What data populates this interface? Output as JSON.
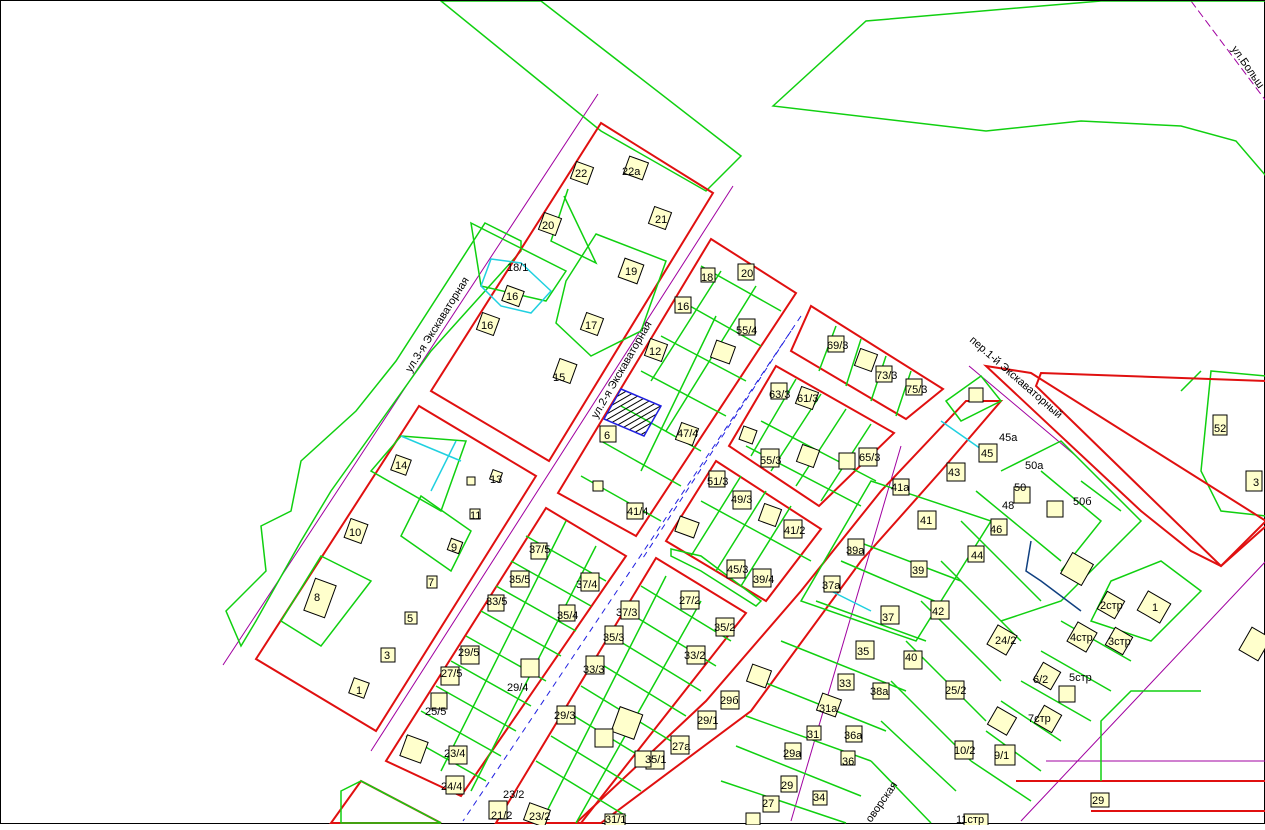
{
  "map": {
    "colors": {
      "parcel_red": "#e01010",
      "lot_green": "#10d010",
      "road_magenta": "#a000a0",
      "road_pink": "#c060c0",
      "building_fill": "#ffffcc",
      "cyan": "#20d0e0",
      "blue_dashed": "#2020e0",
      "dark_red": "#a00000"
    },
    "streets": {
      "ekskavatornaya3": "ул.3-я Экскаваторная",
      "ekskavatornaya2": "ул.2-я Экскаваторная",
      "per_ekskavatorny1": "пер.1-й Экскаваторный",
      "bolshaya": "ул.Больш",
      "ovorskaya": "оворская"
    },
    "lots": {
      "l22": "22",
      "l22a": "22а",
      "l21": "21",
      "l20": "20",
      "l19": "19",
      "l18_1": "18/1",
      "l16a": "16",
      "l16b": "16",
      "l17": "17",
      "l15": "15",
      "l14": "14",
      "l13": "13",
      "l12a": "12",
      "l11": "11",
      "l10": "10",
      "l9": "9",
      "l8": "8",
      "l7": "7",
      "l5": "5",
      "l3": "3",
      "l1": "1",
      "l18": "18",
      "l20b": "20",
      "l16c": "16",
      "l55_4": "55/4",
      "l12b": "12",
      "l6": "6",
      "l47_4": "47/4",
      "l41_4": "41/4",
      "l69_3": "69/3",
      "l73_3": "73/3",
      "l75_3": "75/3",
      "l63_3": "63/3",
      "l61_3": "61/3",
      "l55_3": "55/3",
      "l65_3": "65/3",
      "l51_3": "51/3",
      "l49_3": "49/3",
      "l41_2": "41/2",
      "l45_3": "45/3",
      "l39_4": "39/4",
      "l37_5": "37/5",
      "l35_5": "35/5",
      "l37_4": "37/4",
      "l33_5": "33/5",
      "l35_4": "35/4",
      "l29_5": "29/5",
      "l27_5": "27/5",
      "l29_4": "29/4",
      "l25_5": "25/5",
      "l23_4": "23/4",
      "l24_4": "24/4",
      "l23_2": "23/2",
      "l21_2": "21/2",
      "l23_2b": "23/2",
      "l27_2": "27/2",
      "l37_3": "37/3",
      "l35_2": "35/2",
      "l35_3": "35/3",
      "l33_2": "33/2",
      "l33_3": "33/3",
      "l29_3": "29/3",
      "l29b": "29б",
      "l29_1": "29/1",
      "l27a": "27а",
      "l35_1": "35/1",
      "l31_1": "31/1",
      "l39a": "39а",
      "l37a": "37а",
      "l41a": "41а",
      "l41": "41",
      "l39": "39",
      "l37": "37",
      "l35": "35",
      "l33": "33",
      "l31a": "31а",
      "l31": "31",
      "l29a": "29а",
      "l29": "29",
      "l27": "27",
      "l36a": "36а",
      "l36": "36",
      "l38a": "38а",
      "l34": "34",
      "l45a": "45а",
      "l45": "45",
      "l43": "43",
      "l50a": "50а",
      "l50": "50",
      "l48": "48",
      "l50b": "50б",
      "l46": "46",
      "l44": "44",
      "l42": "42",
      "l40": "40",
      "l24_2": "24/2",
      "l25_2": "25/2",
      "l10_2": "10/2",
      "l9_1": "9/1",
      "l11str": "11стр",
      "l6_2": "6/2",
      "l7str": "7стр",
      "l5str": "5стр",
      "l4str": "4стр",
      "l3str": "3стр",
      "l2str": "2стр",
      "l1b": "1",
      "l52": "52",
      "l3r": "3",
      "l29r": "29"
    }
  }
}
